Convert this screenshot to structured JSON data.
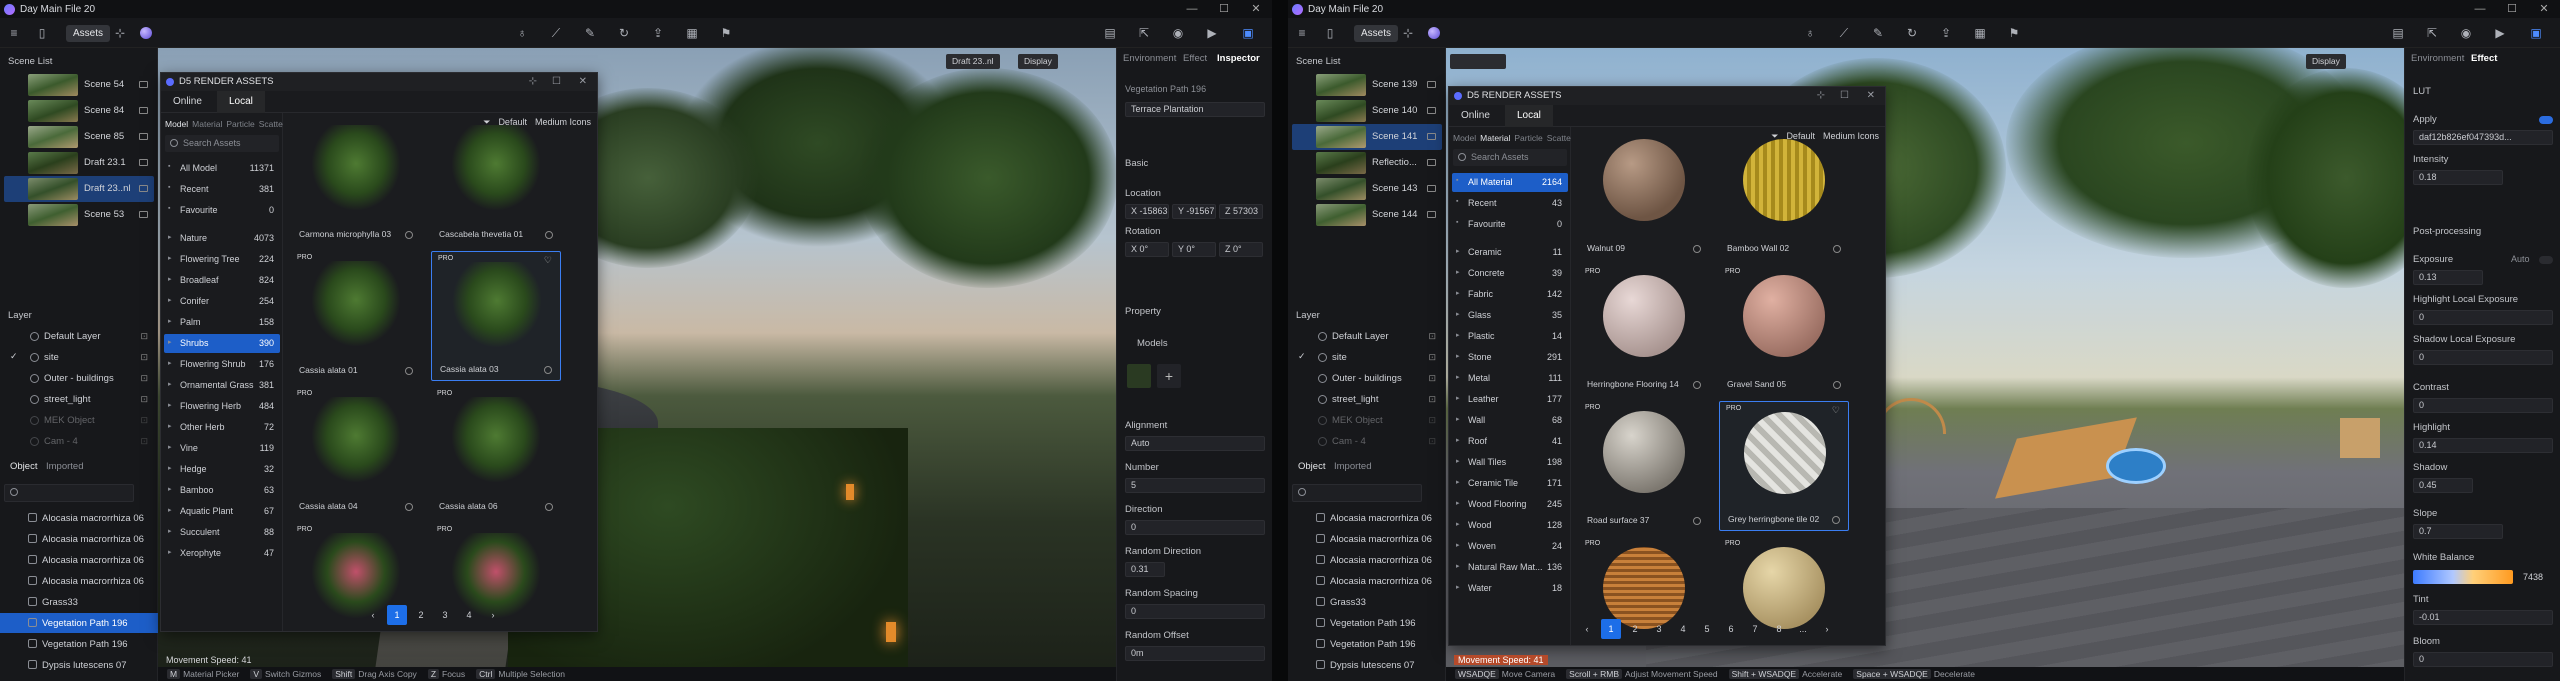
{
  "windows": [
    {
      "title": "Day Main File 20",
      "toolbar": {
        "assets_label": "Assets"
      },
      "scene_list": {
        "title": "Scene List",
        "items": [
          {
            "label": "Scene 54"
          },
          {
            "label": "Scene 84"
          },
          {
            "label": "Scene 85"
          },
          {
            "label": "Draft 23.1"
          },
          {
            "label": "Draft 23..nl",
            "selected": true
          },
          {
            "label": "Scene 53"
          }
        ]
      },
      "layer": {
        "title": "Layer",
        "items": [
          {
            "label": "Default Layer"
          },
          {
            "label": "site",
            "checked": true
          },
          {
            "label": "Outer - buildings"
          },
          {
            "label": "street_light"
          },
          {
            "label": "MEK Object"
          },
          {
            "label": "Cam - 4"
          }
        ]
      },
      "objects": {
        "tab_object": "Object",
        "tab_imported": "Imported",
        "items": [
          {
            "label": "Alocasia macrorrhiza 06"
          },
          {
            "label": "Alocasia macrorrhiza 06"
          },
          {
            "label": "Alocasia macrorrhiza 06"
          },
          {
            "label": "Alocasia macrorrhiza 06"
          },
          {
            "label": "Grass33"
          },
          {
            "label": "Vegetation Path 196",
            "selected": true
          },
          {
            "label": "Vegetation Path 196"
          },
          {
            "label": "Dypsis lutescens 07"
          }
        ]
      },
      "asset_window": {
        "title": "D5 RENDER ASSETS",
        "tab_online": "Online",
        "tab_local": "Local",
        "categories": [
          "Model",
          "Material",
          "Particle",
          "Scatter"
        ],
        "active_category": "Model",
        "search_placeholder": "Search Assets",
        "sort": "Default",
        "view": "Medium Icons",
        "top_rows": [
          {
            "name": "All Model",
            "count": "11371"
          },
          {
            "name": "Recent",
            "count": "381"
          },
          {
            "name": "Favourite",
            "count": "0"
          }
        ],
        "tree": [
          {
            "name": "Nature",
            "count": "4073"
          },
          {
            "name": "Flowering Tree",
            "count": "224"
          },
          {
            "name": "Broadleaf",
            "count": "824"
          },
          {
            "name": "Conifer",
            "count": "254"
          },
          {
            "name": "Palm",
            "count": "158"
          },
          {
            "name": "Shrubs",
            "count": "390",
            "selected": true
          },
          {
            "name": "Flowering Shrub",
            "count": "176"
          },
          {
            "name": "Ornamental Grass",
            "count": "381"
          },
          {
            "name": "Flowering Herb",
            "count": "484"
          },
          {
            "name": "Other Herb",
            "count": "72"
          },
          {
            "name": "Vine",
            "count": "119"
          },
          {
            "name": "Hedge",
            "count": "32"
          },
          {
            "name": "Bamboo",
            "count": "63"
          },
          {
            "name": "Aquatic Plant",
            "count": "67"
          },
          {
            "name": "Succulent",
            "count": "88"
          },
          {
            "name": "Xerophyte",
            "count": "47"
          }
        ],
        "cells": [
          {
            "label": "Carmona microphylla 03"
          },
          {
            "label": "Cascabela thevetia 01"
          },
          {
            "label": "Cassia alata 01",
            "pro": "PRO"
          },
          {
            "label": "Cassia alata 03",
            "pro": "PRO",
            "selected": true
          },
          {
            "label": "Cassia alata 04",
            "pro": "PRO"
          },
          {
            "label": "Cassia alata 06",
            "pro": "PRO"
          },
          {
            "label": "",
            "pro": "PRO"
          },
          {
            "label": "",
            "pro": "PRO"
          }
        ],
        "pages": [
          "1",
          "2",
          "3",
          "4"
        ]
      },
      "viewport": {
        "chip": "Draft 23..nl",
        "display": "Display",
        "speed": "Movement Speed: 41"
      },
      "status": [
        {
          "key": "M",
          "text": "Material Picker"
        },
        {
          "key": "V",
          "text": "Switch Gizmos"
        },
        {
          "key": "Shift",
          "text": "Drag Axis Copy"
        },
        {
          "key": "Z",
          "text": "Focus"
        },
        {
          "key": "Ctrl",
          "text": "Multiple Selection"
        }
      ],
      "inspector": {
        "tabs": [
          "Environment",
          "Effect",
          "Inspector"
        ],
        "active_tab": "Inspector",
        "name": "Vegetation Path 196",
        "preset": "Terrace Plantation",
        "basic": "Basic",
        "location": "Location",
        "loc_x": "X -15863",
        "loc_y": "Y -91567",
        "loc_z": "Z 57303",
        "rotation": "Rotation",
        "rot_x": "X 0°",
        "rot_y": "Y 0°",
        "rot_z": "Z 0°",
        "property": "Property",
        "models": "Models",
        "alignment": "Alignment",
        "alignment_value": "Auto",
        "number": "Number",
        "number_value": "5",
        "direction": "Direction",
        "direction_value": "0",
        "random_direction": "Random Direction",
        "random_direction_value": "0.31",
        "random_spacing": "Random Spacing",
        "random_spacing_value": "0",
        "random_offset": "Random Offset",
        "random_offset_value": "0m"
      }
    },
    {
      "title": "Day Main File 20",
      "toolbar": {
        "assets_label": "Assets"
      },
      "scene_list": {
        "title": "Scene List",
        "items": [
          {
            "label": "Scene 139"
          },
          {
            "label": "Scene 140"
          },
          {
            "label": "Scene 141",
            "selected": true
          },
          {
            "label": "Reflectio..."
          },
          {
            "label": "Scene 143"
          },
          {
            "label": "Scene 144"
          }
        ]
      },
      "layer": {
        "title": "Layer",
        "items": [
          {
            "label": "Default Layer"
          },
          {
            "label": "site",
            "checked": true
          },
          {
            "label": "Outer - buildings"
          },
          {
            "label": "street_light"
          },
          {
            "label": "MEK Object"
          },
          {
            "label": "Cam - 4"
          }
        ]
      },
      "objects": {
        "tab_object": "Object",
        "tab_imported": "Imported",
        "items": [
          {
            "label": "Alocasia macrorrhiza 06"
          },
          {
            "label": "Alocasia macrorrhiza 06"
          },
          {
            "label": "Alocasia macrorrhiza 06"
          },
          {
            "label": "Alocasia macrorrhiza 06"
          },
          {
            "label": "Grass33"
          },
          {
            "label": "Vegetation Path 196"
          },
          {
            "label": "Vegetation Path 196"
          },
          {
            "label": "Dypsis lutescens 07"
          }
        ]
      },
      "asset_window": {
        "title": "D5 RENDER ASSETS",
        "tab_online": "Online",
        "tab_local": "Local",
        "categories": [
          "Model",
          "Material",
          "Particle",
          "Scatter"
        ],
        "active_category": "Material",
        "search_placeholder": "Search Assets",
        "sort": "Default",
        "view": "Medium Icons",
        "top_rows": [
          {
            "name": "All Material",
            "count": "2164",
            "selected": true
          },
          {
            "name": "Recent",
            "count": "43"
          },
          {
            "name": "Favourite",
            "count": "0"
          }
        ],
        "tree": [
          {
            "name": "Ceramic",
            "count": "11"
          },
          {
            "name": "Concrete",
            "count": "39"
          },
          {
            "name": "Fabric",
            "count": "142"
          },
          {
            "name": "Glass",
            "count": "35"
          },
          {
            "name": "Plastic",
            "count": "14"
          },
          {
            "name": "Stone",
            "count": "291"
          },
          {
            "name": "Metal",
            "count": "111"
          },
          {
            "name": "Leather",
            "count": "177"
          },
          {
            "name": "Wall",
            "count": "68"
          },
          {
            "name": "Roof",
            "count": "41"
          },
          {
            "name": "Wall Tiles",
            "count": "198"
          },
          {
            "name": "Ceramic Tile",
            "count": "171"
          },
          {
            "name": "Wood Flooring",
            "count": "245"
          },
          {
            "name": "Wood",
            "count": "128"
          },
          {
            "name": "Woven",
            "count": "24"
          },
          {
            "name": "Natural Raw Mat...",
            "count": "136"
          },
          {
            "name": "Water",
            "count": "18"
          }
        ],
        "cells": [
          {
            "label": "Walnut 09"
          },
          {
            "label": "Bamboo Wall 02"
          },
          {
            "label": "Herringbone Flooring 14",
            "pro": "PRO"
          },
          {
            "label": "Gravel Sand 05",
            "pro": "PRO"
          },
          {
            "label": "Road surface 37",
            "pro": "PRO"
          },
          {
            "label": "Grey herringbone tile 02",
            "pro": "PRO",
            "selected": true
          },
          {
            "label": "",
            "pro": "PRO"
          },
          {
            "label": "",
            "pro": "PRO"
          }
        ],
        "pages": [
          "1",
          "2",
          "3",
          "4",
          "5",
          "6",
          "7",
          "8",
          "..."
        ]
      },
      "viewport": {
        "chip": "",
        "display": "Display",
        "speed": "Movement Speed: 41"
      },
      "status": [
        {
          "key": "WSADQE",
          "text": "Move Camera"
        },
        {
          "key": "Scroll + RMB",
          "text": "Adjust Movement Speed"
        },
        {
          "key": "Shift + WSADQE",
          "text": "Accelerate"
        },
        {
          "key": "Space + WSADQE",
          "text": "Decelerate"
        }
      ],
      "effect": {
        "tabs": [
          "Environment",
          "Effect"
        ],
        "active_tab": "Effect",
        "lut": "LUT",
        "apply": "Apply",
        "lut_file": "daf12b826ef047393d...",
        "intensity": "Intensity",
        "intensity_value": "0.18",
        "post": "Post-processing",
        "exposure": "Exposure",
        "exposure_auto": "Auto",
        "exposure_value": "0.13",
        "hle": "Highlight Local Exposure",
        "hle_value": "0",
        "sle": "Shadow Local Exposure",
        "sle_value": "0",
        "contrast": "Contrast",
        "contrast_value": "0",
        "highlight": "Highlight",
        "highlight_value": "0.14",
        "shadow": "Shadow",
        "shadow_value": "0.45",
        "slope": "Slope",
        "slope_value": "0.7",
        "white_balance": "White Balance",
        "wb_value": "7438",
        "tint": "Tint",
        "tint_value": "-0.01",
        "bloom": "Bloom",
        "bloom_value": "0"
      }
    }
  ],
  "colors": {
    "accent": "#1d5ec8",
    "selection": "#1d3f77",
    "panel": "#17181b",
    "pager_active": "#1d6ee8"
  }
}
